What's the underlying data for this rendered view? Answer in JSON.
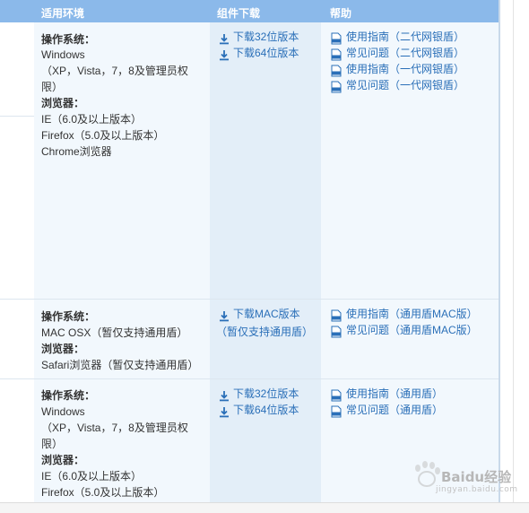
{
  "header": {
    "env_col": "适用环境",
    "download_col": "组件下载",
    "help_col": "帮助"
  },
  "rows": [
    {
      "env": {
        "os_label": "操作系统：",
        "os_line1": "Windows",
        "os_line2": "（XP，Vista，7，8及管理员权",
        "os_line3": "限）",
        "browser_label": "浏览器：",
        "browser_line1": "IE（6.0及以上版本）",
        "browser_line2": "Firefox（5.0及以上版本）",
        "browser_line3": "Chrome浏览器"
      },
      "downloads": [
        "下载32位版本",
        "下载64位版本"
      ],
      "help": [
        "使用指南（二代网银盾）",
        "常见问题（二代网银盾）",
        "使用指南（一代网银盾）",
        "常见问题（一代网银盾）"
      ]
    },
    {
      "env": {
        "os_label": "操作系统：",
        "os_line1": "MAC OSX（暂仅支持通用盾）",
        "browser_label": "浏览器：",
        "browser_line1": "Safari浏览器（暂仅支持通用盾）"
      },
      "downloads": [
        "下载MAC版本"
      ],
      "download_note": "（暂仅支持通用盾）",
      "help": [
        "使用指南（通用盾MAC版）",
        "常见问题（通用盾MAC版）"
      ]
    },
    {
      "env": {
        "os_label": "操作系统：",
        "os_line1": "Windows",
        "os_line2": "（XP，Vista，7，8及管理员权",
        "os_line3": "限）",
        "browser_label": "浏览器：",
        "browser_line1": "IE（6.0及以上版本）",
        "browser_line2": "Firefox（5.0及以上版本）"
      },
      "downloads": [
        "下载32位版本",
        "下载64位版本"
      ],
      "help": [
        "使用指南（通用盾）",
        "常见问题（通用盾）"
      ]
    }
  ],
  "watermark": {
    "text": "Baidu经验",
    "sub": "jingyan.baidu.com"
  },
  "colors": {
    "header_bg": "#8bb9ea",
    "link": "#2a6fb8",
    "cell_bg_light": "#f2f8fd",
    "cell_bg_dark": "#e3eef8"
  }
}
